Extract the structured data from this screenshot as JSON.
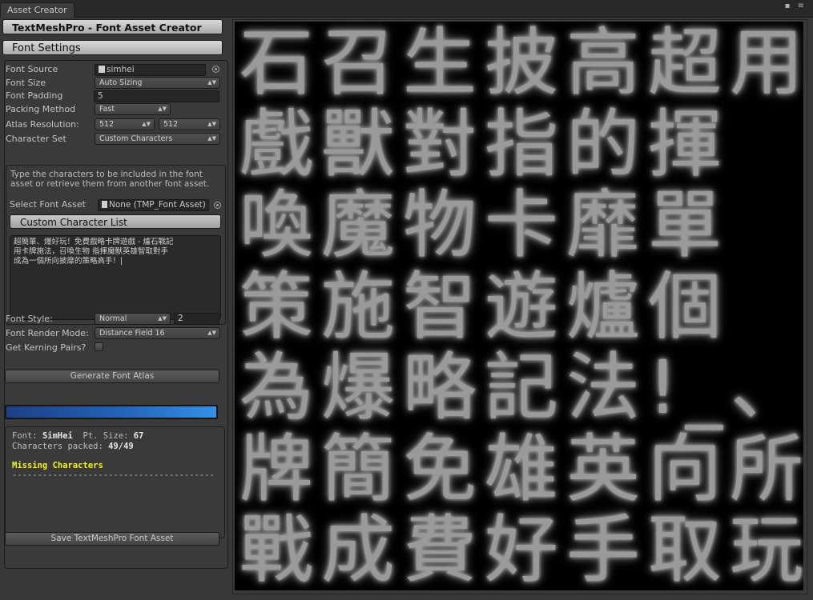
{
  "window": {
    "tab_title": "Asset Creator",
    "controls": "▪ ≡"
  },
  "header": {
    "title": "TextMeshPro - Font Asset Creator",
    "section": "Font Settings"
  },
  "settings": {
    "font_source_label": "Font Source",
    "font_source_value": "simhei",
    "font_size_label": "Font Size",
    "font_size_value": "Auto Sizing",
    "font_padding_label": "Font Padding",
    "font_padding_value": "5",
    "packing_method_label": "Packing Method",
    "packing_method_value": "Fast",
    "atlas_resolution_label": "Atlas Resolution:",
    "atlas_width": "512",
    "atlas_height": "512",
    "character_set_label": "Character Set",
    "character_set_value": "Custom Characters"
  },
  "characters": {
    "help_text": "Type the characters to be included in the font asset or retrieve them from another font asset.",
    "select_font_asset_label": "Select Font Asset",
    "select_font_asset_value": "None (TMP_Font Asset)",
    "custom_list_button": "Custom Character List",
    "custom_text": "超簡單、爆好玩！免費戲略卡牌遊戲 - 爐石戰記\n用卡牌施法，召喚生物 指揮魔獸英雄智取對手\n成為一個所向披靡的策略高手！|"
  },
  "style": {
    "font_style_label": "Font Style:",
    "font_style_value": "Normal",
    "font_style_amount": "2",
    "render_mode_label": "Font Render Mode:",
    "render_mode_value": "Distance Field 16",
    "kerning_label": "Get Kerning Pairs?",
    "kerning_checked": false
  },
  "actions": {
    "generate_label": "Generate Font Atlas",
    "progress": 1.0,
    "save_label": "Save TextMeshPro Font Asset"
  },
  "info": {
    "font_label": "Font: ",
    "font_value": "SimHei",
    "pt_label": "  Pt. Size: ",
    "pt_value": "67",
    "packed_label": "Characters packed: ",
    "packed_value": "49/49",
    "missing_label": "Missing Characters",
    "divider": "----------------------------------------"
  },
  "atlas_preview": {
    "rows": [
      "石召生披高超用",
      "戲獸對指的揮",
      "喚魔物卡靡單",
      "策施智遊爐個",
      "為爆略記法!_、",
      "牌簡免雄英向所",
      "戰成費好手取玩"
    ]
  },
  "colors": {
    "accent_progress": "#2463b8",
    "missing_text": "#f5f31a"
  }
}
